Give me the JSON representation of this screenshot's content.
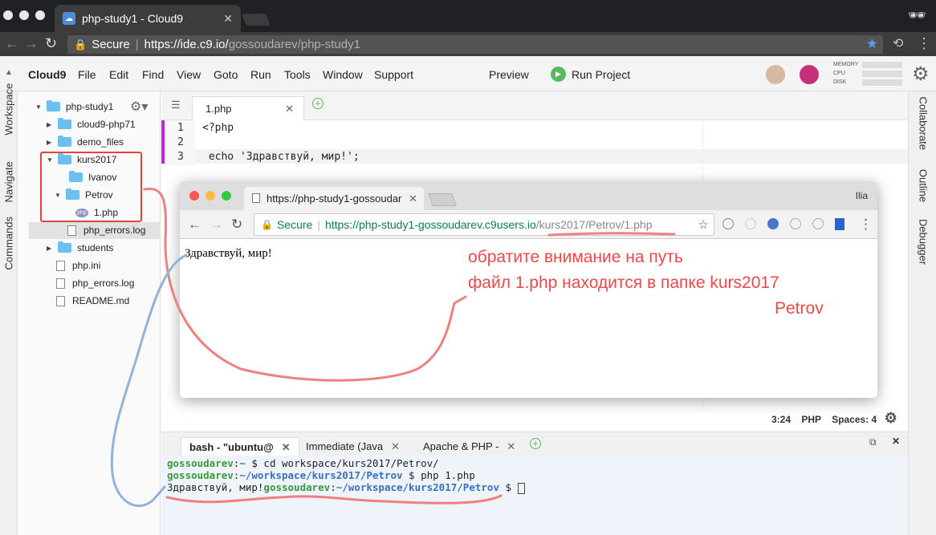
{
  "browser": {
    "tab_title": "php-study1 - Cloud9",
    "secure_label": "Secure",
    "url_host": "https://ide.c9.io/",
    "url_path": "gossoudarev/php-study1"
  },
  "menu": {
    "brand": "Cloud9",
    "items": [
      "File",
      "Edit",
      "Find",
      "View",
      "Goto",
      "Run",
      "Tools",
      "Window",
      "Support"
    ],
    "preview": "Preview",
    "run_project": "Run Project",
    "stats": {
      "memory": "MEMORY",
      "cpu": "CPU",
      "disk": "DISK"
    }
  },
  "left_panels": [
    "Workspace",
    "Navigate",
    "Commands"
  ],
  "right_panels": [
    "Collaborate",
    "Outline",
    "Debugger"
  ],
  "tree": {
    "root": "php-study1",
    "items": [
      "cloud9-php71",
      "demo_files",
      "kurs2017",
      "Ivanov",
      "Petrov",
      "1.php",
      "php_errors.log",
      "students",
      "php.ini",
      "php_errors.log",
      "README.md"
    ]
  },
  "editor": {
    "tab": "1.php",
    "line_numbers": [
      "1",
      "2",
      "3"
    ],
    "lines": [
      "<?php",
      "",
      " echo 'Здравствуй, мир!';"
    ],
    "status": {
      "position": "3:24",
      "lang": "PHP",
      "spaces": "Spaces: 4"
    }
  },
  "popup": {
    "tab_title": "https://php-study1-gossoudar",
    "user": "Ilia",
    "secure_label": "Secure",
    "url_host": "https://php-study1-gossoudarev.c9users.io",
    "url_path": "/kurs2017/Petrov/1.php",
    "content": "Здравствуй, мир!"
  },
  "annotation": {
    "line1": "обратите внимание на путь",
    "line2": "файл 1.php находится в папке kurs2017",
    "line3": "Petrov"
  },
  "terminal": {
    "tabs": [
      "bash - \"ubuntu@",
      "Immediate (Java",
      "Apache & PHP -"
    ],
    "user": "gossoudarev",
    "line1_path": "~",
    "line1_cmd": " $ cd workspace/kurs2017/Petrov/",
    "line2_path": "~/workspace/kurs2017/Petrov",
    "line2_cmd": " $ php 1.php",
    "line3_out": "Здравствуй, мир!",
    "line3_path": "~/workspace/kurs2017/Petrov",
    "line3_prompt": " $ "
  },
  "colors": {
    "accent_red": "#f04848",
    "annotation_blue": "#8fb3dc",
    "run_green": "#5cb85c"
  }
}
